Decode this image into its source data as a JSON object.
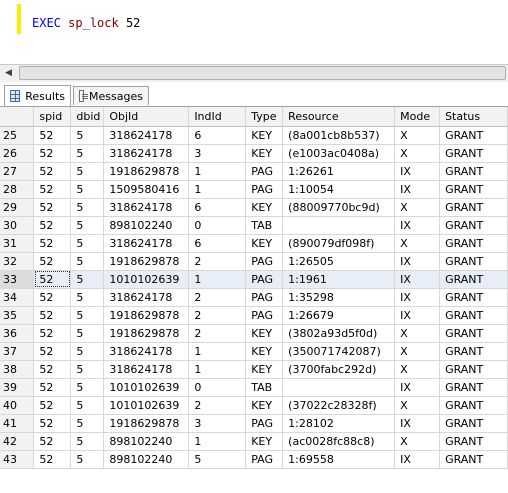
{
  "editor": {
    "keyword": "EXEC",
    "procedure": "sp_lock",
    "argument": "52"
  },
  "tabs": [
    {
      "label": "Results",
      "icon": "grid-icon",
      "active": true
    },
    {
      "label": "Messages",
      "icon": "messages-icon",
      "active": false
    }
  ],
  "columns": [
    "",
    "spid",
    "dbid",
    "ObjId",
    "IndId",
    "Type",
    "Resource",
    "Mode",
    "Status"
  ],
  "selected_row": 8,
  "rows": [
    [
      "25",
      "52",
      "5",
      "318624178",
      "6",
      "KEY",
      "(8a001cb8b537)",
      "X",
      "GRANT"
    ],
    [
      "26",
      "52",
      "5",
      "318624178",
      "3",
      "KEY",
      "(e1003ac0408a)",
      "X",
      "GRANT"
    ],
    [
      "27",
      "52",
      "5",
      "1918629878",
      "1",
      "PAG",
      "1:26261",
      "IX",
      "GRANT"
    ],
    [
      "28",
      "52",
      "5",
      "1509580416",
      "1",
      "PAG",
      "1:10054",
      "IX",
      "GRANT"
    ],
    [
      "29",
      "52",
      "5",
      "318624178",
      "6",
      "KEY",
      "(88009770bc9d)",
      "X",
      "GRANT"
    ],
    [
      "30",
      "52",
      "5",
      "898102240",
      "0",
      "TAB",
      "",
      "IX",
      "GRANT"
    ],
    [
      "31",
      "52",
      "5",
      "318624178",
      "6",
      "KEY",
      "(890079df098f)",
      "X",
      "GRANT"
    ],
    [
      "32",
      "52",
      "5",
      "1918629878",
      "2",
      "PAG",
      "1:26505",
      "IX",
      "GRANT"
    ],
    [
      "33",
      "52",
      "5",
      "1010102639",
      "1",
      "PAG",
      "1:1961",
      "IX",
      "GRANT"
    ],
    [
      "34",
      "52",
      "5",
      "318624178",
      "2",
      "PAG",
      "1:35298",
      "IX",
      "GRANT"
    ],
    [
      "35",
      "52",
      "5",
      "1918629878",
      "2",
      "PAG",
      "1:26679",
      "IX",
      "GRANT"
    ],
    [
      "36",
      "52",
      "5",
      "1918629878",
      "2",
      "KEY",
      "(3802a93d5f0d)",
      "X",
      "GRANT"
    ],
    [
      "37",
      "52",
      "5",
      "318624178",
      "1",
      "KEY",
      "(350071742087)",
      "X",
      "GRANT"
    ],
    [
      "38",
      "52",
      "5",
      "318624178",
      "1",
      "KEY",
      "(3700fabc292d)",
      "X",
      "GRANT"
    ],
    [
      "39",
      "52",
      "5",
      "1010102639",
      "0",
      "TAB",
      "",
      "IX",
      "GRANT"
    ],
    [
      "40",
      "52",
      "5",
      "1010102639",
      "2",
      "KEY",
      "(37022c28328f)",
      "X",
      "GRANT"
    ],
    [
      "41",
      "52",
      "5",
      "1918629878",
      "3",
      "PAG",
      "1:28102",
      "IX",
      "GRANT"
    ],
    [
      "42",
      "52",
      "5",
      "898102240",
      "1",
      "KEY",
      "(ac0028fc88c8)",
      "X",
      "GRANT"
    ],
    [
      "43",
      "52",
      "5",
      "898102240",
      "5",
      "PAG",
      "1:69558",
      "IX",
      "GRANT"
    ]
  ]
}
